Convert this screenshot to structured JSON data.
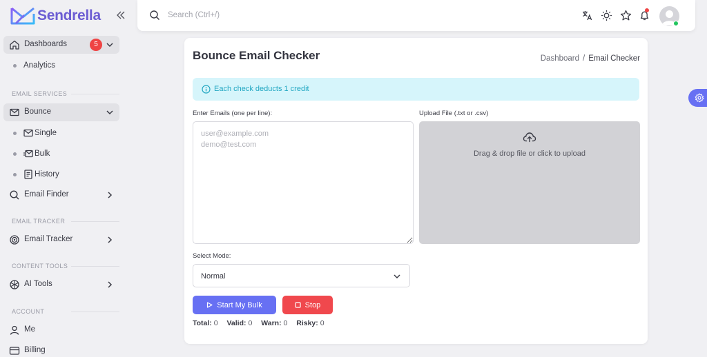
{
  "app": {
    "name": "Sendrella"
  },
  "sidebar": {
    "dashboards": {
      "label": "Dashboards",
      "badge": "5"
    },
    "analytics": {
      "label": "Analytics"
    },
    "sections": {
      "email_services": "EMAIL SERVICES",
      "email_tracker": "EMAIL TRACKER",
      "content_tools": "CONTENT TOOLS",
      "account": "ACCOUNT"
    },
    "bounce": {
      "label": "Bounce"
    },
    "bounce_sub": [
      {
        "label": "Single"
      },
      {
        "label": "Bulk"
      },
      {
        "label": "History"
      }
    ],
    "email_finder": {
      "label": "Email Finder"
    },
    "email_tracker": {
      "label": "Email Tracker"
    },
    "ai_tools": {
      "label": "AI Tools"
    },
    "me": {
      "label": "Me"
    },
    "billing": {
      "label": "Billing"
    }
  },
  "topbar": {
    "search": {
      "placeholder": "Search (Ctrl+/)",
      "value": ""
    },
    "icons": [
      "translate-icon",
      "sun-icon",
      "star-icon",
      "bell-icon"
    ]
  },
  "main": {
    "title": "Bounce Email Checker",
    "breadcrumb": {
      "parent": "Dashboard",
      "separator": "/",
      "current": "Email Checker"
    },
    "alert": "Each check deducts 1 credit",
    "emails_label": "Enter Emails (one per line):",
    "emails_placeholder": "user@example.com\ndemo@test.com",
    "upload_label": "Upload File (.txt or .csv)",
    "upload_text": "Drag & drop file or click to upload",
    "mode_label": "Select Mode:",
    "mode_value": "Normal",
    "start_button": "Start My Bulk",
    "stop_button": "Stop",
    "stats": [
      {
        "label": "Total:",
        "value": "0"
      },
      {
        "label": "Valid:",
        "value": "0"
      },
      {
        "label": "Warn:",
        "value": "0"
      },
      {
        "label": "Risky:",
        "value": "0"
      }
    ]
  },
  "colors": {
    "accent": "#6770f3",
    "brand": "#6c5dd3",
    "danger": "#f0484d",
    "alert_bg": "#d6f5fb",
    "alert_text": "#22a7c2",
    "online": "#22c55e"
  }
}
